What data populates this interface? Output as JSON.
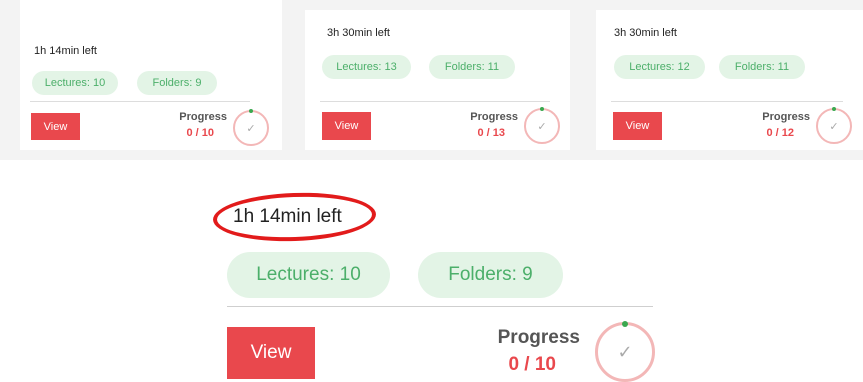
{
  "cards": [
    {
      "time_left": "1h 14min left",
      "lectures": "Lectures: 10",
      "folders": "Folders: 9",
      "view_label": "View",
      "progress_label": "Progress",
      "progress_value": "0 / 10"
    },
    {
      "time_left": "3h 30min left",
      "lectures": "Lectures: 13",
      "folders": "Folders: 11",
      "view_label": "View",
      "progress_label": "Progress",
      "progress_value": "0 / 13"
    },
    {
      "time_left": "3h 30min left",
      "lectures": "Lectures: 12",
      "folders": "Folders: 11",
      "view_label": "View",
      "progress_label": "Progress",
      "progress_value": "0 / 12"
    }
  ],
  "zoom": {
    "time_left": "1h 14min left",
    "lectures": "Lectures: 10",
    "folders": "Folders: 9",
    "view_label": "View",
    "progress_label": "Progress",
    "progress_value": "0 / 10"
  },
  "icons": {
    "progress": "check-icon"
  },
  "colors": {
    "accent": "#e9484d",
    "pill_bg": "#e3f4e6",
    "pill_text": "#4caf6a",
    "highlight": "#e21b1b"
  }
}
